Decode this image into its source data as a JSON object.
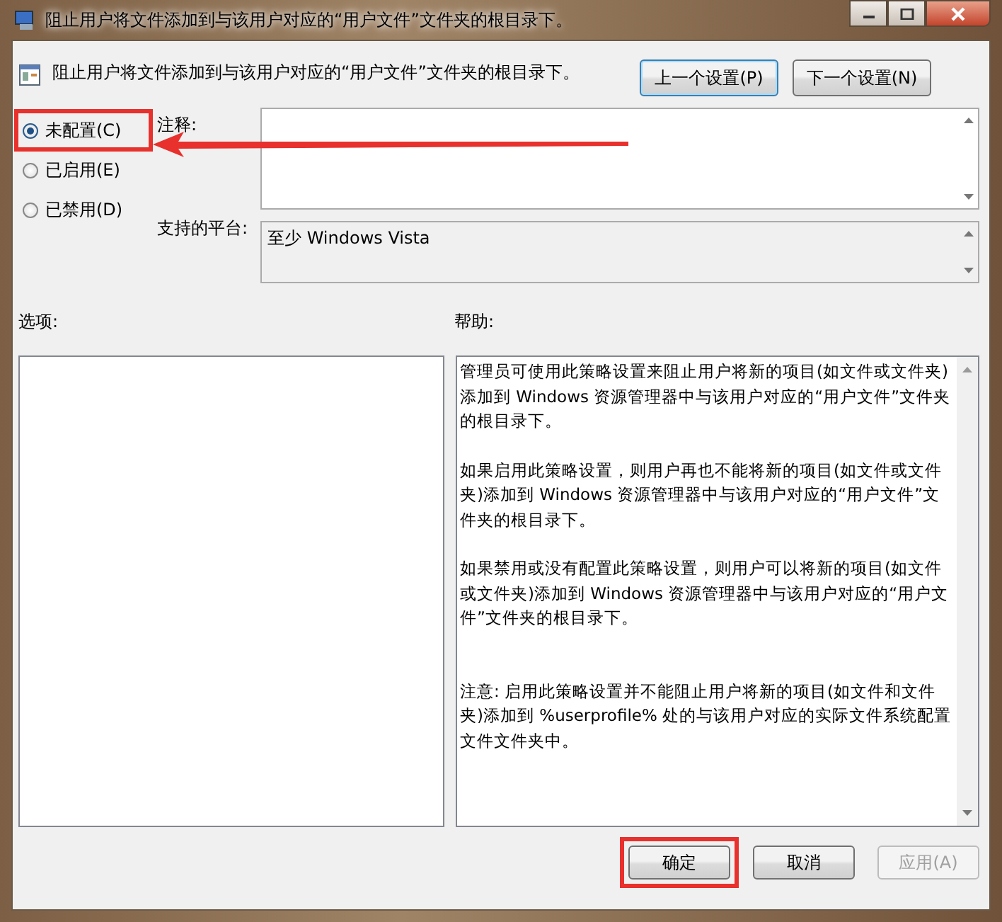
{
  "window": {
    "title": "阻止用户将文件添加到与该用户对应的“用户文件”文件夹的根目录下。"
  },
  "header": {
    "setting_name": "阻止用户将文件添加到与该用户对应的“用户文件”文件夹的根目录下。",
    "buttons": [
      {
        "label": "上一个设置(P)",
        "focused": true
      },
      {
        "label": "下一个设置(N)",
        "focused": false
      }
    ]
  },
  "state_options": [
    {
      "label": "未配置(C)",
      "selected": true
    },
    {
      "label": "已启用(E)",
      "selected": false
    },
    {
      "label": "已禁用(D)",
      "selected": false
    }
  ],
  "comment": {
    "label": "注释:"
  },
  "platform": {
    "label": "支持的平台:",
    "value": "至少 Windows Vista"
  },
  "options": {
    "label": "选项:"
  },
  "help": {
    "label": "帮助:",
    "paragraphs": [
      "管理员可使用此策略设置来阻止用户将新的项目(如文件或文件夹)添加到 Windows 资源管理器中与该用户对应的“用户文件”文件夹的根目录下。",
      "如果启用此策略设置，则用户再也不能将新的项目(如文件或文件夹)添加到 Windows 资源管理器中与该用户对应的“用户文件”文件夹的根目录下。",
      "如果禁用或没有配置此策略设置，则用户可以将新的项目(如文件或文件夹)添加到 Windows 资源管理器中与该用户对应的“用户文件”文件夹的根目录下。",
      "注意: 启用此策略设置并不能阻止用户将新的项目(如文件和文件夹)添加到 %userprofile% 处的与该用户对应的实际文件系统配置文件文件夹中。"
    ]
  },
  "footer_buttons": [
    {
      "label": "确定",
      "disabled": false
    },
    {
      "label": "取消",
      "disabled": false
    },
    {
      "label": "应用(A)",
      "disabled": true
    }
  ]
}
